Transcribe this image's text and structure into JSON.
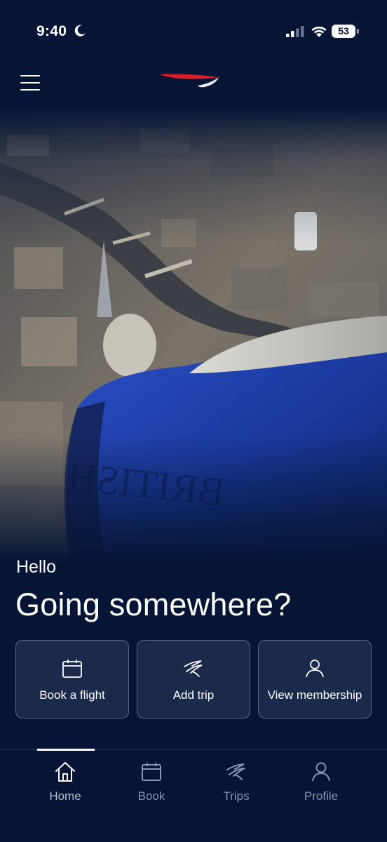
{
  "status_bar": {
    "time": "9:40",
    "battery": "53",
    "icons": [
      "moon-icon",
      "cellular-signal-icon",
      "wifi-icon",
      "battery-icon"
    ]
  },
  "header": {
    "menu_icon": "hamburger-menu-icon",
    "logo": "british-airways-speedmarque-logo"
  },
  "greeting": {
    "small": "Hello",
    "large": "Going somewhere?"
  },
  "actions": [
    {
      "label": "Book a flight",
      "icon": "calendar-icon"
    },
    {
      "label": "Add trip",
      "icon": "plane-trip-icon"
    },
    {
      "label": "View membership",
      "icon": "person-icon"
    }
  ],
  "tabs": [
    {
      "label": "Home",
      "icon": "home-icon",
      "active": true
    },
    {
      "label": "Book",
      "icon": "calendar-icon",
      "active": false
    },
    {
      "label": "Trips",
      "icon": "plane-trip-icon",
      "active": false
    },
    {
      "label": "Profile",
      "icon": "person-icon",
      "active": false
    }
  ],
  "colors": {
    "background": "#061535",
    "card": "#1b2a4a",
    "card_border": "#5c6683",
    "accent_red": "#d61f26",
    "engine_blue": "#1e3fa8",
    "inactive_tab": "#8a93ab"
  }
}
